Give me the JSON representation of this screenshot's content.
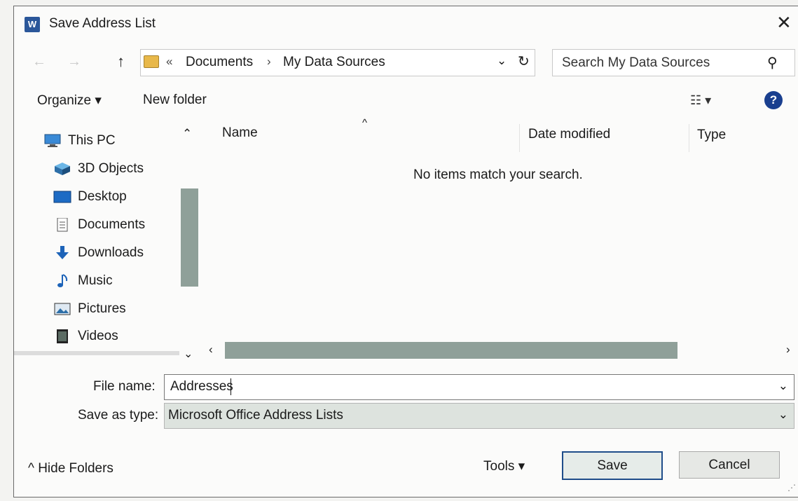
{
  "window": {
    "title": "Save Address List",
    "app_icon": "word-icon",
    "app_icon_letter": "W",
    "close_glyph": "✕"
  },
  "navigation": {
    "back_glyph": "←",
    "forward_glyph": "→",
    "up_glyph": "↑",
    "address": {
      "overflow": "«",
      "crumbs": [
        "Documents",
        "My Data Sources"
      ],
      "separator": "›",
      "dropdown_glyph": "⌄",
      "refresh_glyph": "↻"
    },
    "search": {
      "placeholder": "Search My Data Sources",
      "icon_glyph": "⚲"
    }
  },
  "toolbar": {
    "organize_label": "Organize ▾",
    "new_folder_label": "New folder",
    "view_glyph": "☷ ▾",
    "help_glyph": "?"
  },
  "nav_pane": {
    "items": [
      {
        "label": "This PC",
        "icon": "computer-icon"
      },
      {
        "label": "3D Objects",
        "icon": "cube-icon"
      },
      {
        "label": "Desktop",
        "icon": "desktop-icon"
      },
      {
        "label": "Documents",
        "icon": "document-icon"
      },
      {
        "label": "Downloads",
        "icon": "download-icon"
      },
      {
        "label": "Music",
        "icon": "music-icon"
      },
      {
        "label": "Pictures",
        "icon": "pictures-icon"
      },
      {
        "label": "Videos",
        "icon": "video-icon"
      }
    ],
    "scroll_up_glyph": "⌃",
    "scroll_down_glyph": "⌄"
  },
  "file_list": {
    "columns": [
      "Name",
      "Date modified",
      "Type"
    ],
    "sort_glyph": "^",
    "empty_message": "No items match your search.",
    "scroll_left_glyph": "‹",
    "scroll_right_glyph": "›"
  },
  "fields": {
    "file_name_label": "File name:",
    "file_name_value": "Addresses",
    "save_as_type_label": "Save as type:",
    "save_as_type_value": "Microsoft Office Address Lists",
    "dropdown_glyph": "⌄"
  },
  "footer": {
    "hide_folders_label": "^ Hide Folders",
    "tools_label": "Tools   ▾",
    "save_label": "Save",
    "cancel_label": "Cancel",
    "grip_glyph": "⋰"
  },
  "colors": {
    "accent": "#1f4d8a",
    "word_brand": "#2b579a",
    "scroll_thumb": "#8fa099",
    "help_icon": "#1a3f8f"
  }
}
